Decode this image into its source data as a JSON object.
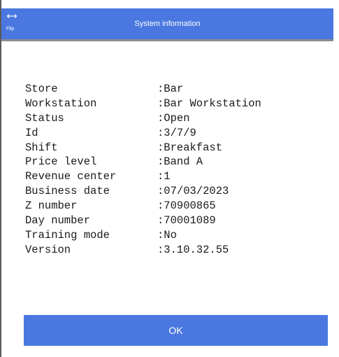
{
  "title_bar": {
    "flip_label": "Flip",
    "flip_icon": "horizontal-double-arrow-icon",
    "title": "System information",
    "background_color": "#4a78e0"
  },
  "info": {
    "rows": [
      {
        "label": "Store",
        "value": ":Bar"
      },
      {
        "label": "Workstation",
        "value": ":Bar Workstation"
      },
      {
        "label": "Status",
        "value": ":Open"
      },
      {
        "label": "Id",
        "value": ":3/7/9"
      },
      {
        "label": "Shift",
        "value": ":Breakfast"
      },
      {
        "label": "Price level",
        "value": ":Band A"
      },
      {
        "label": "Revenue center",
        "value": ":1"
      },
      {
        "label": "Business date",
        "value": ":07/03/2023"
      },
      {
        "label": "Z number",
        "value": ":70900865"
      },
      {
        "label": "Day number",
        "value": ":70001089"
      },
      {
        "label": "Training mode",
        "value": ":No"
      },
      {
        "label": "Version",
        "value": ":3.10.32.55"
      }
    ]
  },
  "footer": {
    "ok_label": "OK",
    "button_color": "#4a78e0"
  }
}
